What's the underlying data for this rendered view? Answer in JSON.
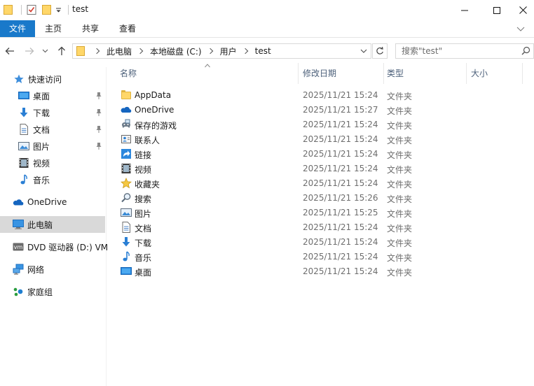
{
  "window": {
    "title": "test"
  },
  "ribbon": {
    "tabs": [
      "文件",
      "主页",
      "共享",
      "查看"
    ]
  },
  "address": {
    "breadcrumbs": [
      "此电脑",
      "本地磁盘 (C:)",
      "用户",
      "test"
    ]
  },
  "search": {
    "placeholder": "搜索\"test\""
  },
  "sidebar": {
    "quick_access": "快速访问",
    "pinned": [
      {
        "label": "桌面",
        "icon": "desktop-icon",
        "pinned": true
      },
      {
        "label": "下载",
        "icon": "download-icon",
        "pinned": true
      },
      {
        "label": "文档",
        "icon": "document-icon",
        "pinned": true
      },
      {
        "label": "图片",
        "icon": "picture-icon",
        "pinned": true
      },
      {
        "label": "视频",
        "icon": "video-icon",
        "pinned": false
      },
      {
        "label": "音乐",
        "icon": "music-icon",
        "pinned": false
      }
    ],
    "onedrive": "OneDrive",
    "this_pc": "此电脑",
    "dvd": "DVD 驱动器 (D:) VM",
    "network": "网络",
    "homegroup": "家庭组"
  },
  "columns": {
    "name": "名称",
    "date": "修改日期",
    "type": "类型",
    "size": "大小"
  },
  "files": [
    {
      "name": "AppData",
      "date": "2025/11/21 15:24",
      "type": "文件夹",
      "icon": "folder-icon"
    },
    {
      "name": "OneDrive",
      "date": "2025/11/21 15:27",
      "type": "文件夹",
      "icon": "onedrive-icon"
    },
    {
      "name": "保存的游戏",
      "date": "2025/11/21 15:24",
      "type": "文件夹",
      "icon": "saved-games-icon"
    },
    {
      "name": "联系人",
      "date": "2025/11/21 15:24",
      "type": "文件夹",
      "icon": "contacts-icon"
    },
    {
      "name": "链接",
      "date": "2025/11/21 15:24",
      "type": "文件夹",
      "icon": "links-icon"
    },
    {
      "name": "视频",
      "date": "2025/11/21 15:24",
      "type": "文件夹",
      "icon": "video-icon"
    },
    {
      "name": "收藏夹",
      "date": "2025/11/21 15:24",
      "type": "文件夹",
      "icon": "favorites-icon"
    },
    {
      "name": "搜索",
      "date": "2025/11/21 15:26",
      "type": "文件夹",
      "icon": "search-icon"
    },
    {
      "name": "图片",
      "date": "2025/11/21 15:25",
      "type": "文件夹",
      "icon": "picture-icon"
    },
    {
      "name": "文档",
      "date": "2025/11/21 15:24",
      "type": "文件夹",
      "icon": "document-icon"
    },
    {
      "name": "下载",
      "date": "2025/11/21 15:24",
      "type": "文件夹",
      "icon": "download-icon"
    },
    {
      "name": "音乐",
      "date": "2025/11/21 15:24",
      "type": "文件夹",
      "icon": "music-icon"
    },
    {
      "name": "桌面",
      "date": "2025/11/21 15:24",
      "type": "文件夹",
      "icon": "desktop-icon"
    }
  ],
  "colors": {
    "accent": "#1979ca",
    "folder": "#ffd769",
    "selected": "#d9d9d9",
    "header_text": "#4c607a"
  }
}
